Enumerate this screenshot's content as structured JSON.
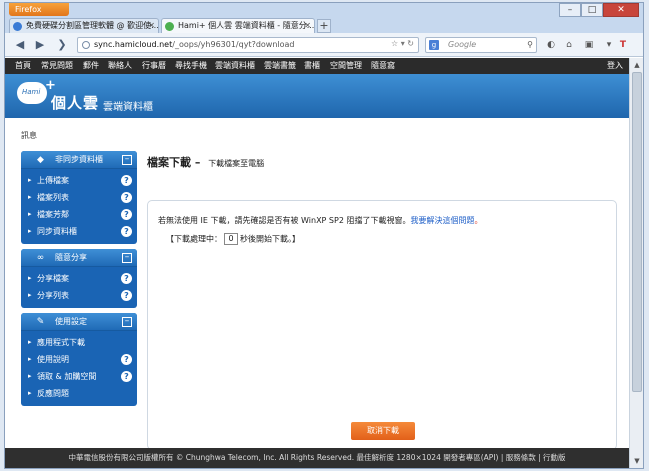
{
  "browser": {
    "app_button": "Firefox",
    "tabs": [
      {
        "label": "免費硬碟分割區管理軟體 @ 歡迎使...",
        "active": false
      },
      {
        "label": "Hami+ 個人雲 雲端資料櫃 - 隨意分...",
        "active": true
      }
    ],
    "new_tab": "+",
    "url_host": "sync.hamicloud.net",
    "url_path": "/_oops/yh96301/qyt?download",
    "search_placeholder": "Google",
    "window_controls": {
      "minimize": "–",
      "maximize": "□",
      "close": "✕"
    }
  },
  "site_menu": {
    "items": [
      "首頁",
      "常見問題",
      "郵件",
      "聯絡人",
      "行事曆",
      "尋找手機",
      "雲端資料櫃",
      "雲端書籤",
      "書櫃",
      "空間管理",
      "隨意窩"
    ],
    "login": "登入"
  },
  "brand": {
    "cloud_text": "Hami",
    "name": "個人雲",
    "subtitle": "雲端資料櫃"
  },
  "notice": "訊息",
  "sidebar": {
    "panels": [
      {
        "title": "非同步資料櫃",
        "icon": "cube-icon",
        "items": [
          {
            "label": "上傳檔案",
            "help": true
          },
          {
            "label": "檔案列表",
            "help": true
          },
          {
            "label": "檔案芳鄰",
            "help": true
          },
          {
            "label": "同步資料櫃",
            "help": true
          }
        ]
      },
      {
        "title": "隨意分享",
        "icon": "link-icon",
        "items": [
          {
            "label": "分享檔案",
            "help": true
          },
          {
            "label": "分享列表",
            "help": true
          }
        ]
      },
      {
        "title": "使用設定",
        "icon": "wrench-icon",
        "items": [
          {
            "label": "應用程式下載",
            "help": false
          },
          {
            "label": "使用說明",
            "help": true
          },
          {
            "label": "領取 & 加購空間",
            "help": true
          },
          {
            "label": "反應問題",
            "help": false
          }
        ]
      }
    ]
  },
  "main": {
    "title": "檔案下載",
    "title_sep": "–",
    "subtitle": "下載檔案至電腦",
    "message_prefix": "若無法使用 IE 下載，請先確認是否有被 WinXP SP2 阻擋了下載視窗。",
    "message_link": "我要解決這個問題",
    "message_dot": "。",
    "countdown_prefix": "【下載處理中：",
    "countdown_value": "0",
    "countdown_suffix": "秒後開始下載。】",
    "cancel_label": "取消下載"
  },
  "footer": "中華電信股份有限公司版權所有 © Chunghwa Telecom, Inc. All Rights Reserved. 最佳解析度 1280×1024  開發者專區(API) | 服務條款 | 行動版",
  "colors": {
    "brand_blue": "#1f66ad",
    "sidebar_blue": "#1a64b4",
    "cancel_orange": "#e2601a",
    "menu_bg": "#2b2b2b"
  }
}
